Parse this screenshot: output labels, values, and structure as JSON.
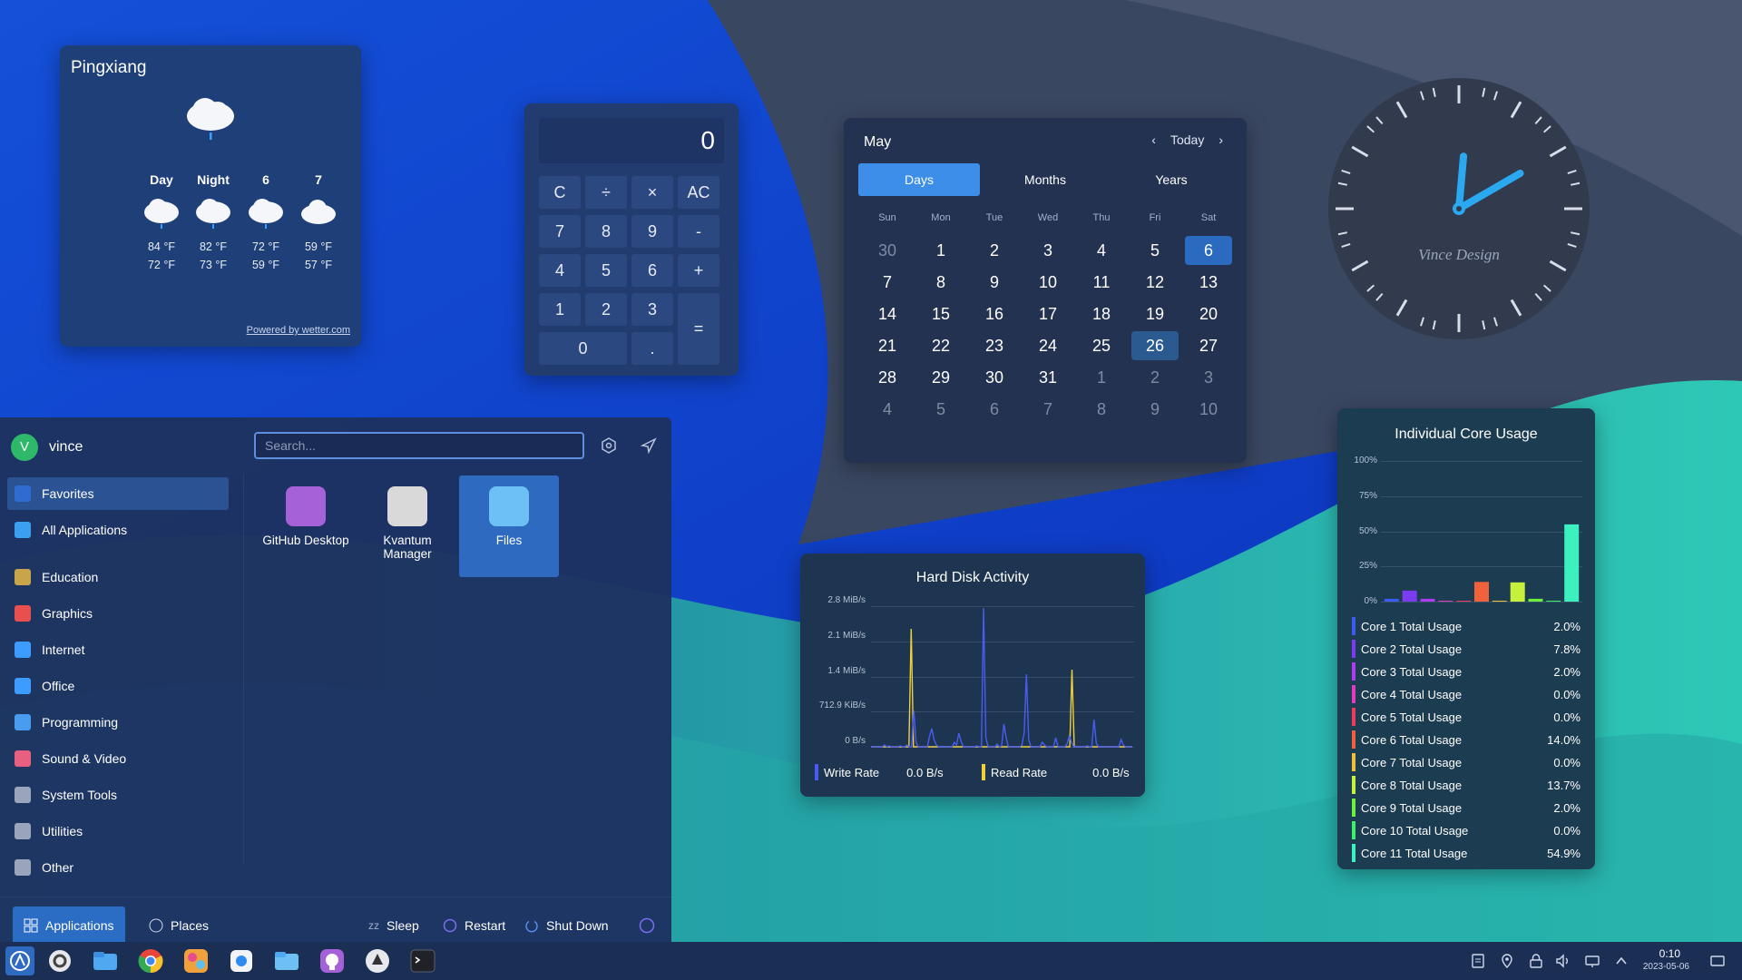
{
  "weather": {
    "city": "Pingxiang",
    "forecast": [
      {
        "day": "Day",
        "hi": "84 °F",
        "lo": "72 °F"
      },
      {
        "day": "Night",
        "hi": "82 °F",
        "lo": "73 °F"
      },
      {
        "day": "6",
        "hi": "72 °F",
        "lo": "59 °F"
      },
      {
        "day": "7",
        "hi": "59 °F",
        "lo": "57 °F"
      }
    ],
    "powered_by": "Powered by wetter.com"
  },
  "calculator": {
    "display": "0",
    "keys": [
      "C",
      "÷",
      "×",
      "AC",
      "7",
      "8",
      "9",
      "-",
      "4",
      "5",
      "6",
      "+",
      "1",
      "2",
      "3",
      "=",
      "0",
      "."
    ]
  },
  "calendar": {
    "month": "May",
    "today_label": "Today",
    "tabs": [
      "Days",
      "Months",
      "Years"
    ],
    "weekdays": [
      "Sun",
      "Mon",
      "Tue",
      "Wed",
      "Thu",
      "Fri",
      "Sat"
    ],
    "days": [
      "30",
      "1",
      "2",
      "3",
      "4",
      "5",
      "6",
      "7",
      "8",
      "9",
      "10",
      "11",
      "12",
      "13",
      "14",
      "15",
      "16",
      "17",
      "18",
      "19",
      "20",
      "21",
      "22",
      "23",
      "24",
      "25",
      "26",
      "27",
      "28",
      "29",
      "30",
      "31",
      "1",
      "2",
      "3",
      "4",
      "5",
      "6",
      "7",
      "8",
      "9",
      "10"
    ]
  },
  "clock": {
    "brand": "Vince Design",
    "hour": 0,
    "minute": 10
  },
  "start_menu": {
    "user": "vince",
    "avatar_letter": "V",
    "search_placeholder": "Search...",
    "categories": [
      "Favorites",
      "All Applications",
      "Education",
      "Graphics",
      "Internet",
      "Office",
      "Programming",
      "Sound & Video",
      "System Tools",
      "Utilities",
      "Other"
    ],
    "apps": [
      {
        "label": "GitHub Desktop",
        "color": "#a561d8"
      },
      {
        "label": "Kvantum Manager",
        "color": "#d9d9d9"
      },
      {
        "label": "Files",
        "color": "#6cc0f4"
      }
    ],
    "footer": {
      "applications": "Applications",
      "places": "Places",
      "sleep": "Sleep",
      "restart": "Restart",
      "shutdown": "Shut Down"
    }
  },
  "disk": {
    "title": "Hard Disk Activity",
    "ticks": [
      "2.8 MiB/s",
      "2.1 MiB/s",
      "1.4 MiB/s",
      "712.9 KiB/s",
      "0 B/s"
    ],
    "write_label": "Write Rate",
    "write_value": "0.0 B/s",
    "read_label": "Read Rate",
    "read_value": "0.0 B/s",
    "write_color": "#4a5cf0",
    "read_color": "#f0cf3c"
  },
  "cores": {
    "title": "Individual Core Usage",
    "ticks": [
      "100%",
      "75%",
      "50%",
      "25%",
      "0%"
    ],
    "items": [
      {
        "name": "Core 1 Total Usage",
        "value": "2.0%",
        "pct": 2.0,
        "color": "#3b5cf0"
      },
      {
        "name": "Core 2 Total Usage",
        "value": "7.8%",
        "pct": 7.8,
        "color": "#7b3cf0"
      },
      {
        "name": "Core 3 Total Usage",
        "value": "2.0%",
        "pct": 2.0,
        "color": "#b03cf0"
      },
      {
        "name": "Core 4 Total Usage",
        "value": "0.0%",
        "pct": 0.0,
        "color": "#e43cc0"
      },
      {
        "name": "Core 5 Total Usage",
        "value": "0.0%",
        "pct": 0.0,
        "color": "#f03c5c"
      },
      {
        "name": "Core 6 Total Usage",
        "value": "14.0%",
        "pct": 14.0,
        "color": "#f0623c"
      },
      {
        "name": "Core 7 Total Usage",
        "value": "0.0%",
        "pct": 0.0,
        "color": "#f0c03c"
      },
      {
        "name": "Core 8 Total Usage",
        "value": "13.7%",
        "pct": 13.7,
        "color": "#c6f03c"
      },
      {
        "name": "Core 9 Total Usage",
        "value": "2.0%",
        "pct": 2.0,
        "color": "#6cf03c"
      },
      {
        "name": "Core 10 Total Usage",
        "value": "0.0%",
        "pct": 0.0,
        "color": "#3cf06a"
      },
      {
        "name": "Core 11 Total Usage",
        "value": "54.9%",
        "pct": 54.9,
        "color": "#3cf0c0"
      }
    ]
  },
  "taskbar": {
    "time": "0:10",
    "date": "2023-05-06"
  }
}
